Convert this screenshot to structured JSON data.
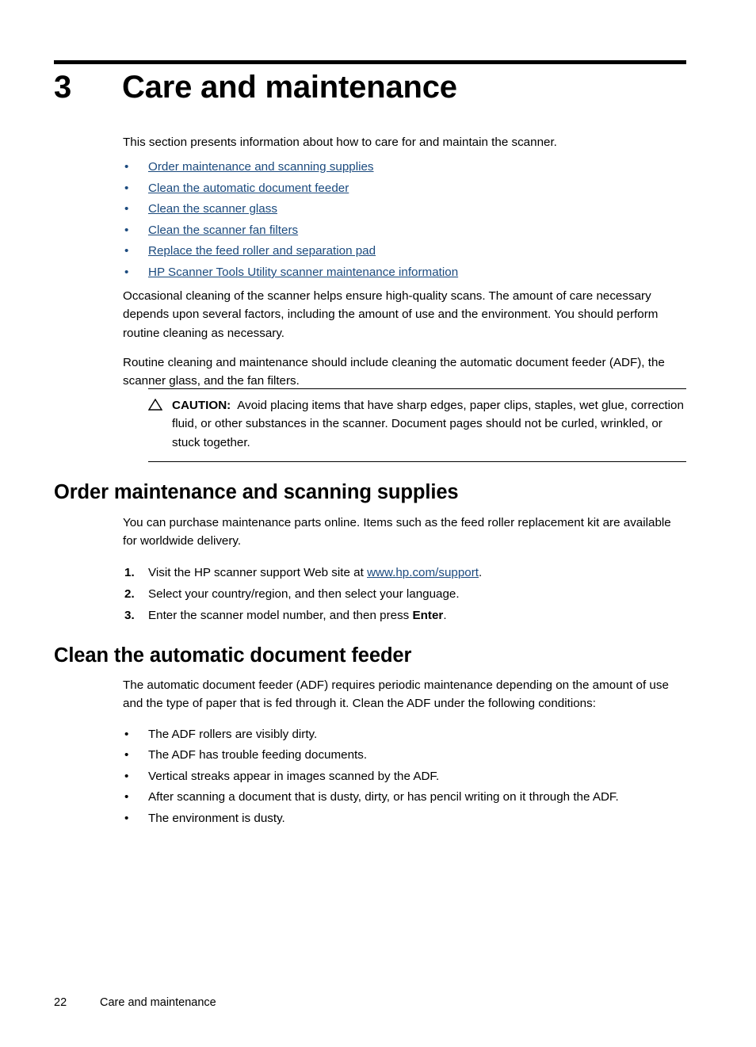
{
  "document": {
    "chapter_number": "3",
    "chapter_title": "Care and maintenance",
    "intro": "This section presents information about how to care for and maintain the scanner."
  },
  "toc_links": [
    {
      "label": "Order maintenance and scanning supplies"
    },
    {
      "label": "Clean the automatic document feeder"
    },
    {
      "label": "Clean the scanner glass"
    },
    {
      "label": "Clean the scanner fan filters"
    },
    {
      "label": "Replace the feed roller and separation pad"
    },
    {
      "label": "HP Scanner Tools Utility scanner maintenance information"
    }
  ],
  "paragraphs": {
    "occasional_cleaning": "Occasional cleaning of the scanner helps ensure high-quality scans. The amount of care necessary depends upon several factors, including the amount of use and the environment. You should perform routine cleaning as necessary.",
    "routine_cleaning": "Routine cleaning and maintenance should include cleaning the automatic document feeder (ADF), the scanner glass, and the fan filters."
  },
  "caution": {
    "icon": "warning-triangle-icon",
    "label": "CAUTION:",
    "text": "Avoid placing items that have sharp edges, paper clips, staples, wet glue, correction fluid, or other substances in the scanner. Document pages should not be curled, wrinkled, or stuck together."
  },
  "section_supplies": {
    "heading": "Order maintenance and scanning supplies",
    "intro": "You can purchase maintenance parts online. Items such as the feed roller replacement kit are available for worldwide delivery.",
    "steps": [
      {
        "number": "1.",
        "text_before": "Visit the HP scanner support Web site at ",
        "link": "www.hp.com/support",
        "text_after": ".",
        "bold": "",
        "bold_after": ""
      },
      {
        "number": "2.",
        "text_before": "Select your country/region, and then select your language.",
        "link": "",
        "text_after": "",
        "bold": "",
        "bold_after": ""
      },
      {
        "number": "3.",
        "text_before": "Enter the scanner model number, and then press ",
        "link": "",
        "text_after": "",
        "bold": "Enter",
        "bold_after": "."
      }
    ]
  },
  "section_adf": {
    "heading": "Clean the automatic document feeder",
    "intro": "The automatic document feeder (ADF) requires periodic maintenance depending on the amount of use and the type of paper that is fed through it. Clean the ADF under the following conditions:",
    "conditions": [
      {
        "label": "The ADF rollers are visibly dirty."
      },
      {
        "label": "The ADF has trouble feeding documents."
      },
      {
        "label": "Vertical streaks appear in images scanned by the ADF."
      },
      {
        "label": "After scanning a document that is dusty, dirty, or has pencil writing on it through the ADF."
      },
      {
        "label": "The environment is dusty."
      }
    ]
  },
  "footer": {
    "page_number": "22",
    "title": "Care and maintenance"
  },
  "colors": {
    "link": "#1b4a7e",
    "text": "#000000",
    "page_background": "#ffffff"
  },
  "bullet_glyph": "•"
}
